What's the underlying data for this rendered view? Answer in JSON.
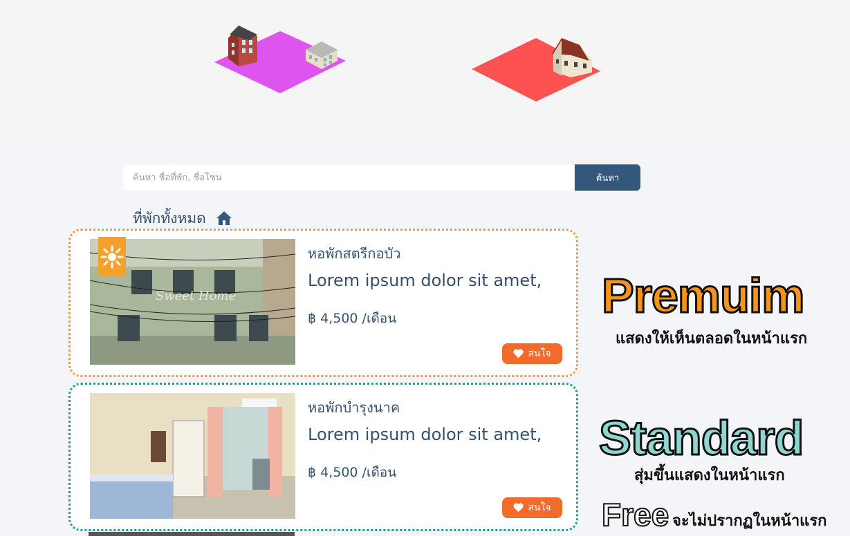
{
  "search": {
    "placeholder": "ค้นหา ชื่อที่พัก, ชื่อโซน",
    "button_label": "ค้นหา"
  },
  "section": {
    "title": "ที่พักทั้งหมด"
  },
  "listings": [
    {
      "tier": "premium",
      "title": "หอพักสตรีกอบัว",
      "description": "Lorem ipsum dolor sit amet,",
      "price": "฿ 4,500 /เดือน",
      "photo_text": "Sweet Home",
      "fav_label": "สนใจ",
      "border_color": "#f39a3a"
    },
    {
      "tier": "standard",
      "title": "หอพักบำรุงนาค",
      "description": "Lorem ipsum dolor sit amet,",
      "price": "฿ 4,500 /เดือน",
      "fav_label": "สนใจ",
      "border_color": "#1aa394"
    }
  ],
  "legend": {
    "premium_title": "Premuim",
    "premium_sub": "แสดงให้เห็นตลอดในหน้าแรก",
    "standard_title": "Standard",
    "standard_sub": "สุ่มขึ้นแสดงในหน้าแรก",
    "free_title": "Free",
    "free_sub": "จะไม่ปรากฏในหน้าแรก"
  },
  "colors": {
    "accent": "#34577c",
    "favorite": "#f26b2a",
    "premium": "#f39a3a",
    "standard_fill": "#8dd7d0"
  },
  "icons": [
    "home-icon",
    "heart-icon",
    "sun-badge-icon"
  ]
}
